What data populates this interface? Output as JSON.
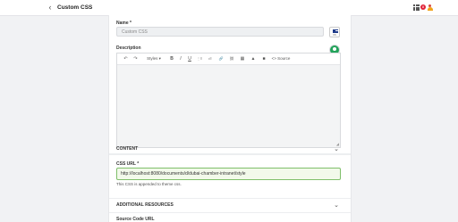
{
  "header": {
    "title": "Custom CSS",
    "notification_count": "8"
  },
  "form": {
    "name_label": "Name *",
    "name_value": "Custom CSS",
    "language": "US",
    "description_label": "Description",
    "toolbar": {
      "undo": "↶",
      "redo": "↷",
      "styles": "Styles",
      "bold": "B",
      "italic": "I",
      "underline": "U",
      "ordered_list": "⋮≡",
      "bulleted_list": "•≡",
      "link": "🔗",
      "unlink": "⛓",
      "table": "▦",
      "image": "▲",
      "media": "■",
      "source": "<> Source"
    },
    "content_section": "CONTENT",
    "css_url_label": "CSS URL *",
    "css_url_value": "http://localhost:8080/documents/d/dubai-chamber-intranet/style",
    "css_url_helper": "This CSS is appended to theme css.",
    "additional_section": "ADDITIONAL RESOURCES",
    "source_code_label": "Source Code URL"
  }
}
